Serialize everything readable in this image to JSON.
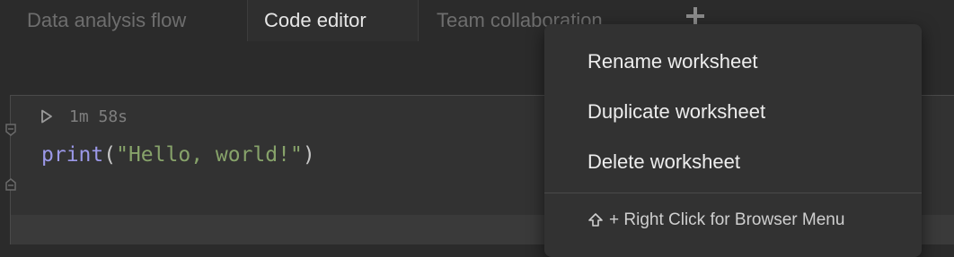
{
  "tabs": [
    {
      "label": "Data analysis flow",
      "active": false
    },
    {
      "label": "Code editor",
      "active": true
    },
    {
      "label": "Team collaboration",
      "active": false
    }
  ],
  "add_tab_icon": "plus-icon",
  "cell": {
    "run_time": "1m 58s",
    "code": {
      "function": "print",
      "open_paren": "(",
      "string": "\"Hello, world!\"",
      "close_paren": ")"
    }
  },
  "context_menu": {
    "items": [
      "Rename worksheet",
      "Duplicate worksheet",
      "Delete worksheet"
    ],
    "hint": "+ Right Click for Browser Menu",
    "hint_icon": "shift-arrow-icon"
  },
  "colors": {
    "background": "#2b2b2b",
    "keyword": "#9b98e8",
    "string": "#87a36a",
    "menu_bg": "#323232"
  }
}
